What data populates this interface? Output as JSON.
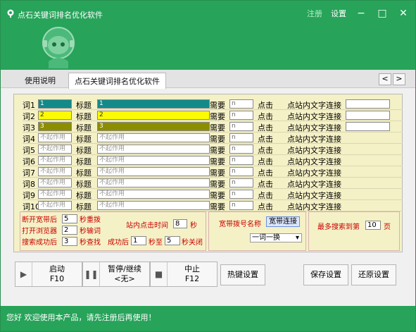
{
  "window": {
    "title": "点石关键词排名优化软件",
    "register_link": "注册",
    "settings_link": "设置",
    "minimize": "−",
    "maximize": "□",
    "close": "✕"
  },
  "tabs": [
    {
      "label": "使用说明"
    },
    {
      "label": "点石关键词排名优化软件"
    }
  ],
  "nav": {
    "prev": "<",
    "next": ">"
  },
  "rows": [
    {
      "label": "词1",
      "keyword": "1",
      "title_label": "标题",
      "title": "1",
      "need_label": "需要",
      "need": "n",
      "click_label": "点击",
      "link_label": "点站内文字连接",
      "color": "teal"
    },
    {
      "label": "词2",
      "keyword": "2",
      "title_label": "标题",
      "title": "2",
      "need_label": "需要",
      "need": "n",
      "click_label": "点击",
      "link_label": "点站内文字连接",
      "color": "yellow"
    },
    {
      "label": "词3",
      "keyword": "3",
      "title_label": "标题",
      "title": "3",
      "need_label": "需要",
      "need": "n",
      "click_label": "点击",
      "link_label": "点站内文字连接",
      "color": "olive"
    },
    {
      "label": "词4",
      "keyword": "不起作用",
      "title_label": "标题",
      "title": "不起作用",
      "need_label": "需要",
      "need": "n",
      "click_label": "点击",
      "link_label": "点站内文字连接",
      "color": "gray"
    },
    {
      "label": "词5",
      "keyword": "不起作用",
      "title_label": "标题",
      "title": "不起作用",
      "need_label": "需要",
      "need": "n",
      "click_label": "点击",
      "link_label": "点站内文字连接",
      "color": "gray"
    },
    {
      "label": "词6",
      "keyword": "不起作用",
      "title_label": "标题",
      "title": "不起作用",
      "need_label": "需要",
      "need": "n",
      "click_label": "点击",
      "link_label": "点站内文字连接",
      "color": "gray"
    },
    {
      "label": "词7",
      "keyword": "不起作用",
      "title_label": "标题",
      "title": "不起作用",
      "need_label": "需要",
      "need": "n",
      "click_label": "点击",
      "link_label": "点站内文字连接",
      "color": "gray"
    },
    {
      "label": "词8",
      "keyword": "不起作用",
      "title_label": "标题",
      "title": "不起作用",
      "need_label": "需要",
      "need": "n",
      "click_label": "点击",
      "link_label": "点站内文字连接",
      "color": "gray"
    },
    {
      "label": "词9",
      "keyword": "不起作用",
      "title_label": "标题",
      "title": "不起作用",
      "need_label": "需要",
      "need": "n",
      "click_label": "点击",
      "link_label": "点站内文字连接",
      "color": "gray"
    },
    {
      "label": "词10",
      "keyword": "不起作用",
      "title_label": "标题",
      "title": "不起作用",
      "need_label": "需要",
      "need": "n",
      "click_label": "点击",
      "link_label": "点站内文字连接",
      "color": "gray"
    }
  ],
  "settings": {
    "reconnect_label": "断开宽带后",
    "reconnect_value": "5",
    "reconnect_unit": "秒重拨",
    "browser_label": "打开浏览器",
    "browser_value": "2",
    "browser_unit": "秒输词",
    "search_label": "搜索成功后",
    "search_value": "3",
    "search_unit": "秒查找",
    "stay_label": "站内点击时间",
    "stay_value": "8",
    "stay_unit": "秒",
    "success_label": "成功后",
    "success_from": "1",
    "success_mid": "秒至",
    "success_to": "5",
    "success_unit": "秒关闭",
    "dial_label": "宽带拨号名称",
    "dial_value": "宽带连接",
    "mode_value": "一词一换",
    "pages_label": "最多搜索到第",
    "pages_value": "10",
    "pages_unit": "页"
  },
  "toolbar": {
    "start": "启动",
    "start_key": "F10",
    "pause": "暂停/继续",
    "pause_key": "<无>",
    "stop": "中止",
    "stop_key": "F12",
    "hotkey": "热键设置",
    "save": "保存设置",
    "restore": "还原设置"
  },
  "status": {
    "text": "您好 欢迎使用本产品，请先注册后再使用！"
  },
  "colors": {
    "brand_green": "#27a35a",
    "panel_bg": "#f5f1c6",
    "teal": "#138a8a",
    "yellow": "#fbfb05",
    "olive": "#8d8d00"
  }
}
